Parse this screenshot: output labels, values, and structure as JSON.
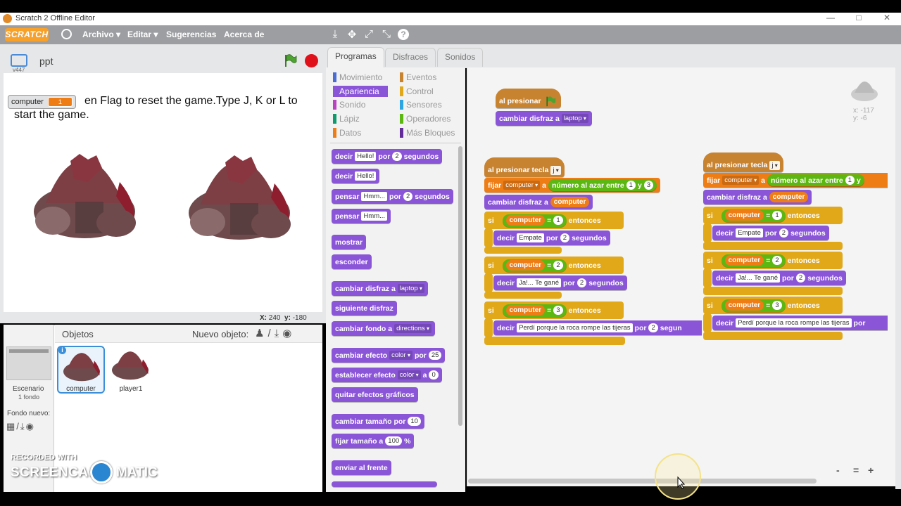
{
  "window": {
    "title": "Scratch 2 Offline Editor"
  },
  "menubar": {
    "logo": "SCRATCH",
    "items": [
      "Archivo ▾",
      "Editar ▾",
      "Sugerencias",
      "Acerca de"
    ]
  },
  "stage": {
    "project_name": "ppt",
    "version": "v447",
    "watcher_label": "computer",
    "watcher_value": "1",
    "say_text": "en Flag to reset the game.Type J, K or L to start the game.",
    "mouse_x_label": "X:",
    "mouse_x": "240",
    "mouse_y_label": "y:",
    "mouse_y": "-180"
  },
  "sprites_pane": {
    "objects_label": "Objetos",
    "new_object_label": "Nuevo objeto:",
    "stage_label": "Escenario",
    "stage_count": "1 fondo",
    "new_backdrop_label": "Fondo nuevo:",
    "sprites": [
      {
        "name": "computer"
      },
      {
        "name": "player1"
      }
    ]
  },
  "tabs": [
    "Programas",
    "Disfraces",
    "Sonidos"
  ],
  "categories": [
    {
      "label": "Movimiento",
      "color": "#4a6cd4"
    },
    {
      "label": "Eventos",
      "color": "#c88330"
    },
    {
      "label": "Apariencia",
      "color": "#8a55d7"
    },
    {
      "label": "Control",
      "color": "#e1a91a"
    },
    {
      "label": "Sonido",
      "color": "#bb42c3"
    },
    {
      "label": "Sensores",
      "color": "#2ca5e2"
    },
    {
      "label": "Lápiz",
      "color": "#0e9a6c"
    },
    {
      "label": "Operadores",
      "color": "#5cb712"
    },
    {
      "label": "Datos",
      "color": "#ee7d16"
    },
    {
      "label": "Más Bloques",
      "color": "#632d99"
    }
  ],
  "palette": {
    "b1": {
      "t1": "decir",
      "i1": "Hello!",
      "t2": "por",
      "n1": "2",
      "t3": "segundos"
    },
    "b2": {
      "t1": "decir",
      "i1": "Hello!"
    },
    "b3": {
      "t1": "pensar",
      "i1": "Hmm...",
      "t2": "por",
      "n1": "2",
      "t3": "segundos"
    },
    "b4": {
      "t1": "pensar",
      "i1": "Hmm..."
    },
    "b5": "mostrar",
    "b6": "esconder",
    "b7": {
      "t1": "cambiar disfraz a",
      "d1": "laptop"
    },
    "b8": "siguiente disfraz",
    "b9": {
      "t1": "cambiar fondo a",
      "d1": "directions"
    },
    "b10": {
      "t1": "cambiar efecto",
      "d1": "color",
      "t2": "por",
      "n1": "25"
    },
    "b11": {
      "t1": "establecer efecto",
      "d1": "color",
      "t2": "a",
      "n1": "0"
    },
    "b12": "quitar efectos gráficos",
    "b13": {
      "t1": "cambiar tamaño por",
      "n1": "10"
    },
    "b14": {
      "t1": "fijar tamaño a",
      "n1": "100",
      "t2": "%"
    },
    "b15": "enviar al frente"
  },
  "scripts": {
    "s1": {
      "hat": "al presionar",
      "b1": "cambiar disfraz a",
      "d1": "laptop"
    },
    "s2": {
      "hat": "al presionar tecla",
      "key": "j",
      "set": {
        "t1": "fijar",
        "var": "computer",
        "t2": "a",
        "t3": "número al azar entre",
        "n1": "1",
        "t4": "y",
        "n2": "3"
      },
      "costume": {
        "t1": "cambiar disfraz a",
        "r1": "computer"
      },
      "if_label": "si",
      "then_label": "entonces",
      "eq": "=",
      "cond_var": "computer",
      "ifs": [
        {
          "n": "1",
          "say": "decir",
          "msg": "Empate",
          "por": "por",
          "secs": "2",
          "seg": "segundos"
        },
        {
          "n": "2",
          "say": "decir",
          "msg": "Ja!... Te gané",
          "por": "por",
          "secs": "2",
          "seg": "segundos"
        },
        {
          "n": "3",
          "say": "decir",
          "msg": "Perdí porque la roca rompe las tijeras",
          "por": "por",
          "secs": "2",
          "seg": "segun"
        }
      ]
    },
    "s3": {
      "hat": "al presionar tecla",
      "key": "j",
      "set": {
        "t1": "fijar",
        "var": "computer",
        "t2": "a",
        "t3": "número al azar entre",
        "n1": "1",
        "t4": "y"
      },
      "costume": {
        "t1": "cambiar disfraz a",
        "r1": "computer"
      },
      "ifs": [
        {
          "n": "1",
          "msg": "Empate",
          "secs": "2",
          "seg": "segundos"
        },
        {
          "n": "2",
          "msg": "Ja!... Te gané",
          "secs": "2",
          "seg": "segundos"
        },
        {
          "n": "3",
          "msg": "Perdí porque la roca rompe las tijeras",
          "por": "por"
        }
      ]
    }
  },
  "sprite_info": {
    "x": "x: -117",
    "y": "y: -6"
  },
  "zoom": [
    "-",
    "=",
    "+"
  ],
  "watermark": {
    "line1": "RECORDED WITH",
    "left": "SCREENCAST",
    "right": "MATIC"
  }
}
